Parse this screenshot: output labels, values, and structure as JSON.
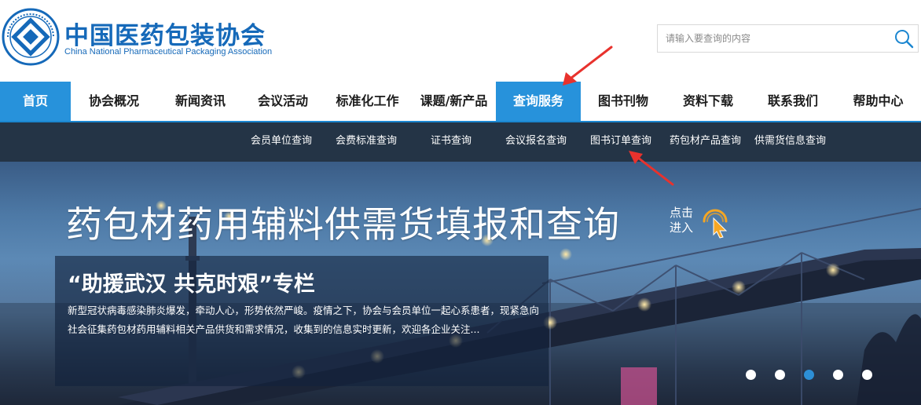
{
  "header": {
    "title": "中国医药包装协会",
    "subtitle": "China National Pharmaceutical Packaging Association"
  },
  "search": {
    "placeholder": "请输入要查询的内容",
    "value": ""
  },
  "nav": {
    "items": [
      {
        "label": "首页",
        "active": true
      },
      {
        "label": "协会概况"
      },
      {
        "label": "新闻资讯"
      },
      {
        "label": "会议活动"
      },
      {
        "label": "标准化工作"
      },
      {
        "label": "课题/新产品"
      },
      {
        "label": "查询服务",
        "active": true
      },
      {
        "label": "图书刊物"
      },
      {
        "label": "资料下载"
      },
      {
        "label": "联系我们"
      },
      {
        "label": "帮助中心"
      }
    ]
  },
  "subnav": {
    "items": [
      {
        "label": "会员单位查询"
      },
      {
        "label": "会费标准查询"
      },
      {
        "label": "证书查询"
      },
      {
        "label": "会议报名查询"
      },
      {
        "label": "图书订单查询"
      },
      {
        "label": "药包材产品查询"
      },
      {
        "label": "供需货信息查询"
      }
    ]
  },
  "banner": {
    "headline": "药包材药用辅料供需货填报和查询",
    "click_enter": "点击进入",
    "feature_title": "“助援武汉 共克时艰”专栏",
    "feature_desc": "新型冠状病毒感染肺炎爆发，牵动人心，形势依然严峻。疫情之下，协会与会员单位一起心系患者，现紧急向社会征集药包材药用辅料相关产品供货和需求情况，收集到的信息实时更新，欢迎各企业关注...",
    "slides": 5,
    "active_slide": 3
  },
  "colors": {
    "brand_blue": "#1569b9",
    "nav_active": "#2792db",
    "subnav_bg": "#243446",
    "annotation_red": "#e8322d",
    "click_icon": "#f5a623"
  }
}
